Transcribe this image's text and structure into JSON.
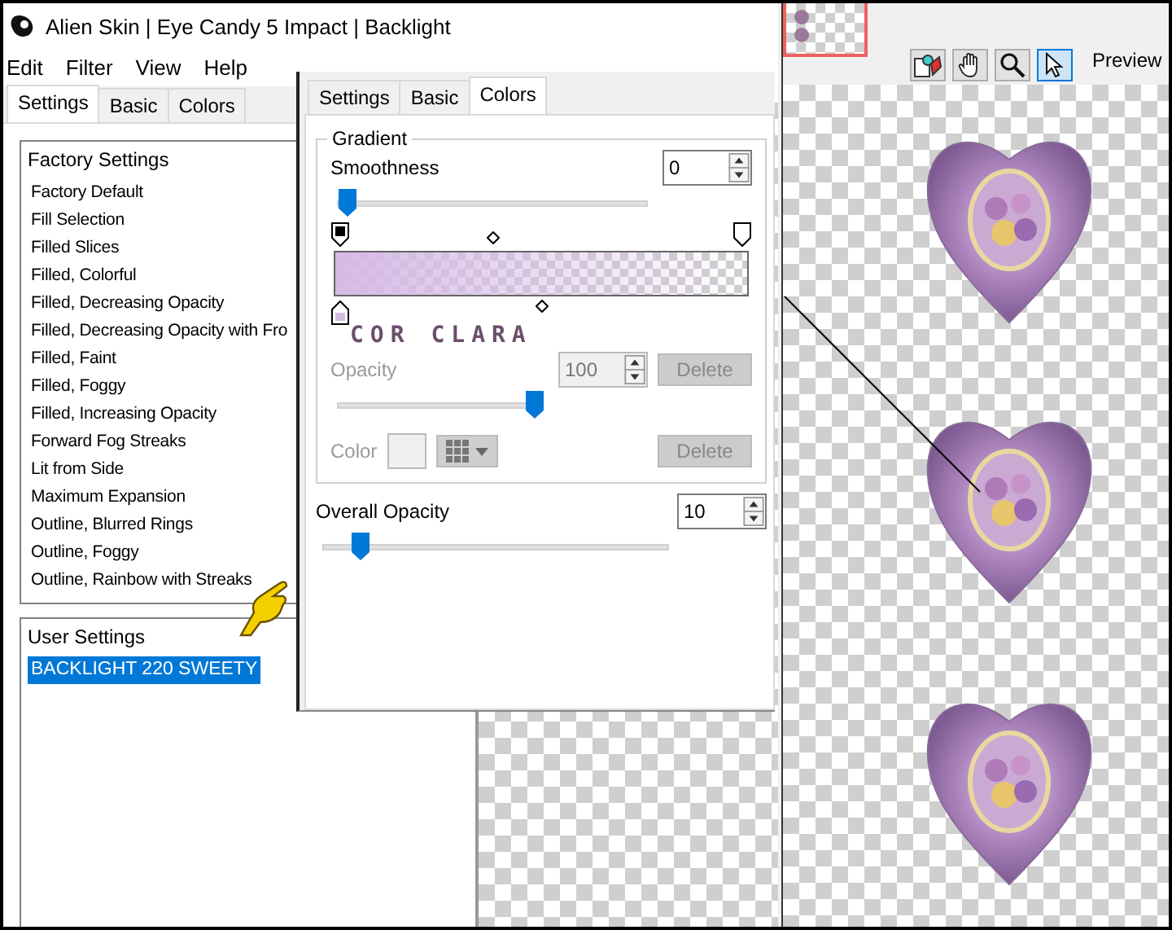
{
  "window": {
    "title": "Alien Skin | Eye Candy 5 Impact | Backlight"
  },
  "menu": [
    "Edit",
    "Filter",
    "View",
    "Help"
  ],
  "tabs": [
    {
      "label": "Settings",
      "selected": true
    },
    {
      "label": "Basic",
      "selected": false
    },
    {
      "label": "Colors",
      "selected": false
    }
  ],
  "factory_settings": {
    "heading": "Factory Settings",
    "items": [
      {
        "label": "Factory Default",
        "selected": false
      },
      {
        "label": "Fill Selection",
        "selected": false
      },
      {
        "label": "Filled Slices",
        "selected": false
      },
      {
        "label": "Filled, Colorful",
        "selected": false
      },
      {
        "label": "Filled, Decreasing Opacity",
        "selected": false
      },
      {
        "label": "Filled, Decreasing Opacity with Fro",
        "selected": false
      },
      {
        "label": "Filled, Faint",
        "selected": false
      },
      {
        "label": "Filled, Foggy",
        "selected": false
      },
      {
        "label": "Filled, Increasing Opacity",
        "selected": false
      },
      {
        "label": "Forward Fog Streaks",
        "selected": false
      },
      {
        "label": "Lit from Side",
        "selected": false
      },
      {
        "label": "Maximum Expansion",
        "selected": false
      },
      {
        "label": "Outline, Blurred Rings",
        "selected": false
      },
      {
        "label": "Outline, Foggy",
        "selected": false
      },
      {
        "label": "Outline, Rainbow with Streaks",
        "selected": false
      }
    ]
  },
  "user_settings": {
    "heading": "User Settings",
    "items": [
      {
        "label": "BACKLIGHT 220 SWEETY",
        "selected": true
      }
    ]
  },
  "dialog": {
    "tabs": [
      {
        "label": "Settings",
        "selected": false
      },
      {
        "label": "Basic",
        "selected": false
      },
      {
        "label": "Colors",
        "selected": true
      }
    ],
    "gradient": {
      "title": "Gradient",
      "smoothness": {
        "label": "Smoothness",
        "value": "0",
        "level": 0.02
      },
      "annotation": "COR CLARA",
      "opacity": {
        "label": "Opacity",
        "value": "100",
        "level": 1,
        "disabled": true
      },
      "color": {
        "label": "Color",
        "disabled": true
      },
      "delete_buttons": [
        {
          "label": "Delete",
          "disabled": true
        },
        {
          "label": "Delete",
          "disabled": true
        }
      ]
    },
    "overall_opacity": {
      "label": "Overall Opacity",
      "value": "10",
      "level": 0.1
    }
  },
  "preview": {
    "label": "Preview",
    "tools": [
      {
        "kind": "swatch",
        "selected": false
      },
      {
        "kind": "hand",
        "selected": false
      },
      {
        "kind": "zoom",
        "selected": false
      },
      {
        "kind": "arrow",
        "selected": true
      }
    ]
  }
}
